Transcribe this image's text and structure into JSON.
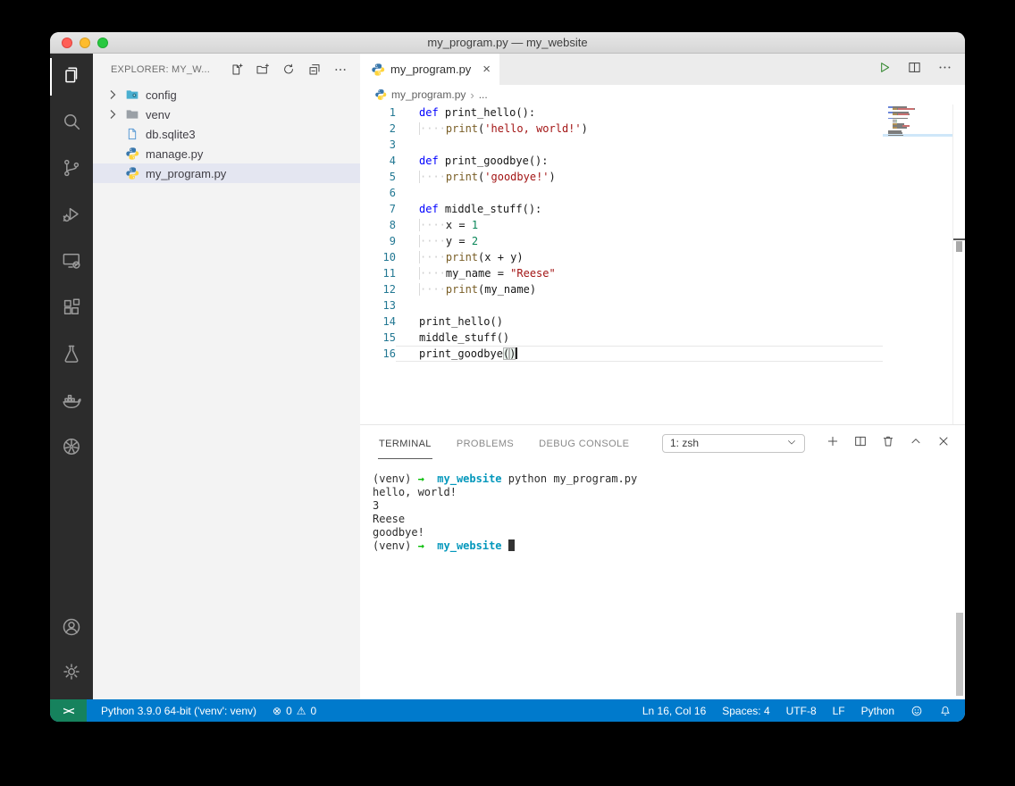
{
  "window": {
    "title": "my_program.py — my_website"
  },
  "colors": {
    "status_bar": "#007acc",
    "remote_indicator": "#16825d",
    "run_button": "#388a34",
    "selected_row": "#e4e6f1",
    "keyword": "#0000ff",
    "function": "#795e26",
    "string": "#a31515",
    "number": "#098658",
    "line_number": "#237893",
    "terminal_green": "#00bc00",
    "terminal_cyan": "#0598bc",
    "activity_bar": "#2c2c2c"
  },
  "activity_bar": {
    "items": [
      {
        "name": "explorer",
        "active": true
      },
      {
        "name": "search"
      },
      {
        "name": "source-control"
      },
      {
        "name": "run-debug"
      },
      {
        "name": "remote-explorer"
      },
      {
        "name": "extensions"
      },
      {
        "name": "testing"
      },
      {
        "name": "docker"
      },
      {
        "name": "kubernetes"
      }
    ],
    "bottom_items": [
      {
        "name": "account"
      },
      {
        "name": "settings"
      }
    ]
  },
  "sidebar": {
    "header": "EXPLORER: MY_W...",
    "actions": [
      "new-file",
      "new-folder",
      "refresh",
      "collapse-all",
      "more-actions"
    ],
    "files": [
      {
        "label": "config",
        "kind": "folder-config",
        "expandable": true
      },
      {
        "label": "venv",
        "kind": "folder",
        "expandable": true
      },
      {
        "label": "db.sqlite3",
        "kind": "file"
      },
      {
        "label": "manage.py",
        "kind": "python"
      },
      {
        "label": "my_program.py",
        "kind": "python",
        "selected": true
      }
    ]
  },
  "editor": {
    "tab": {
      "label": "my_program.py"
    },
    "breadcrumb": {
      "file": "my_program.py",
      "symbol": "..."
    },
    "cursor_line": 16,
    "lines": [
      {
        "n": 1,
        "indent": 0,
        "seg": [
          [
            "kw",
            "def "
          ],
          [
            "txt",
            "print_hello():"
          ]
        ]
      },
      {
        "n": 2,
        "indent": 4,
        "seg": [
          [
            "fn",
            "print"
          ],
          [
            "txt",
            "("
          ],
          [
            "str",
            "'hello, world!'"
          ],
          [
            "txt",
            ")"
          ]
        ]
      },
      {
        "n": 3,
        "indent": 0,
        "seg": []
      },
      {
        "n": 4,
        "indent": 0,
        "seg": [
          [
            "kw",
            "def "
          ],
          [
            "txt",
            "print_goodbye():"
          ]
        ]
      },
      {
        "n": 5,
        "indent": 4,
        "seg": [
          [
            "fn",
            "print"
          ],
          [
            "txt",
            "("
          ],
          [
            "str",
            "'goodbye!'"
          ],
          [
            "txt",
            ")"
          ]
        ]
      },
      {
        "n": 6,
        "indent": 0,
        "seg": []
      },
      {
        "n": 7,
        "indent": 0,
        "seg": [
          [
            "kw",
            "def "
          ],
          [
            "txt",
            "middle_stuff():"
          ]
        ]
      },
      {
        "n": 8,
        "indent": 4,
        "seg": [
          [
            "txt",
            "x = "
          ],
          [
            "num",
            "1"
          ]
        ]
      },
      {
        "n": 9,
        "indent": 4,
        "seg": [
          [
            "txt",
            "y = "
          ],
          [
            "num",
            "2"
          ]
        ]
      },
      {
        "n": 10,
        "indent": 4,
        "seg": [
          [
            "fn",
            "print"
          ],
          [
            "txt",
            "(x + y)"
          ]
        ]
      },
      {
        "n": 11,
        "indent": 4,
        "seg": [
          [
            "txt",
            "my_name = "
          ],
          [
            "str",
            "\"Reese\""
          ]
        ]
      },
      {
        "n": 12,
        "indent": 4,
        "seg": [
          [
            "fn",
            "print"
          ],
          [
            "txt",
            "(my_name)"
          ]
        ]
      },
      {
        "n": 13,
        "indent": 0,
        "seg": []
      },
      {
        "n": 14,
        "indent": 0,
        "seg": [
          [
            "txt",
            "print_hello()"
          ]
        ]
      },
      {
        "n": 15,
        "indent": 0,
        "seg": [
          [
            "txt",
            "middle_stuff()"
          ]
        ]
      },
      {
        "n": 16,
        "indent": 0,
        "seg": [
          [
            "txt",
            "print_goodbye"
          ],
          [
            "bm",
            "("
          ],
          [
            "bm",
            ")"
          ]
        ]
      }
    ]
  },
  "panel": {
    "tabs": [
      {
        "label": "TERMINAL",
        "active": true
      },
      {
        "label": "PROBLEMS"
      },
      {
        "label": "DEBUG CONSOLE"
      }
    ],
    "shell_select": "1: zsh",
    "terminal_lines": [
      {
        "seg": [
          [
            "t",
            "(venv) "
          ],
          [
            "arrow",
            "→"
          ],
          [
            "t",
            "  "
          ],
          [
            "dir",
            "my_website"
          ],
          [
            "t",
            " python my_program.py"
          ]
        ]
      },
      {
        "seg": [
          [
            "t",
            "hello, world!"
          ]
        ]
      },
      {
        "seg": [
          [
            "t",
            "3"
          ]
        ]
      },
      {
        "seg": [
          [
            "t",
            "Reese"
          ]
        ]
      },
      {
        "seg": [
          [
            "t",
            "goodbye!"
          ]
        ]
      },
      {
        "seg": [
          [
            "t",
            "(venv) "
          ],
          [
            "arrow",
            "→"
          ],
          [
            "t",
            "  "
          ],
          [
            "dir",
            "my_website"
          ],
          [
            "t",
            " "
          ]
        ],
        "cursor": true
      }
    ]
  },
  "status_bar": {
    "remote_indicator": "><",
    "interpreter": "Python 3.9.0 64-bit ('venv': venv)",
    "errors": "0",
    "warnings": "0",
    "cursor_position": "Ln 16, Col 16",
    "indentation": "Spaces: 4",
    "encoding": "UTF-8",
    "eol": "LF",
    "language": "Python"
  }
}
